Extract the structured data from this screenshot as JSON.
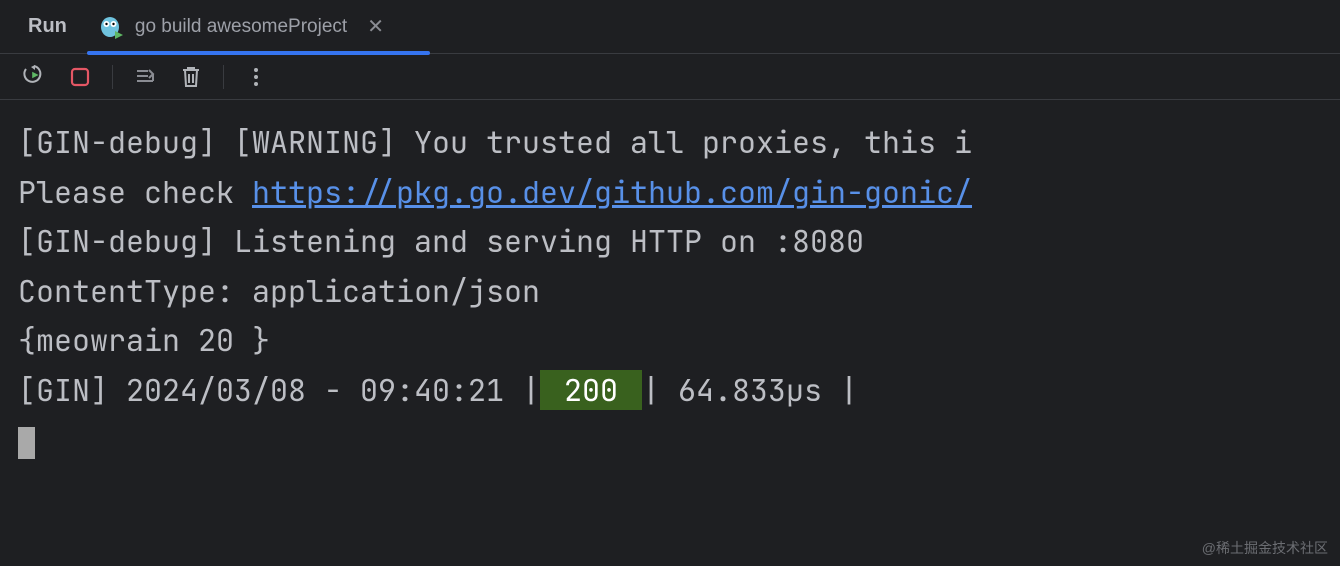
{
  "panel": {
    "title": "Run"
  },
  "tab": {
    "label": "go build awesomeProject"
  },
  "console": {
    "line1_a": "[GIN-debug] [WARNING] You trusted all proxies, this i",
    "line2_a": "Please check ",
    "line2_link": "https://pkg.go.dev/github.com/gin-gonic/",
    "line3": "[GIN-debug] Listening and serving HTTP on :8080",
    "line4": "ContentType: application/json",
    "line5": "{meowrain 20 }",
    "line6_a": "[GIN] 2024/03/08 - 09:40:21 |",
    "line6_status": " 200 ",
    "line6_b": "|     64.833µs |"
  },
  "watermark": "@稀土掘金技术社区"
}
